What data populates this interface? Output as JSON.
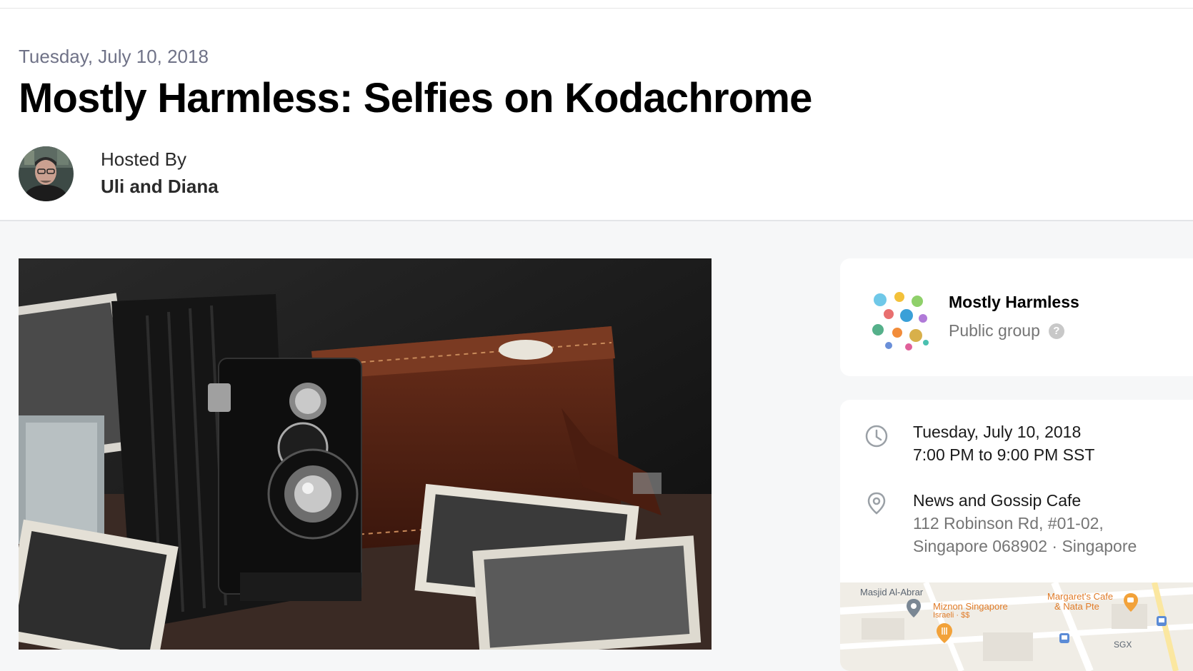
{
  "header": {
    "date": "Tuesday, July 10, 2018",
    "title": "Mostly Harmless: Selfies on Kodachrome",
    "hosted_by_label": "Hosted By",
    "hosts": "Uli and Diana",
    "avatar_icon": "host-avatar"
  },
  "event_image": {
    "icon": "vintage-folding-camera-photo"
  },
  "group": {
    "name": "Mostly Harmless",
    "type": "Public group",
    "help_symbol": "?"
  },
  "details": {
    "date": "Tuesday, July 10, 2018",
    "time": "7:00 PM to 9:00 PM SST",
    "venue_name": "News and Gossip Cafe",
    "address_line1": "112 Robinson Rd, #01-02,",
    "address_line2": "Singapore 068902 · Singapore",
    "clock_icon": "clock-icon",
    "pin_icon": "location-pin-icon"
  },
  "map": {
    "labels": {
      "masjid": "Masjid Al-Abrar",
      "miznon": "Miznon Singapore",
      "miznon_sub": "Israeli · $$",
      "margarets1": "Margaret's Cafe",
      "margarets2": "& Nata Pte",
      "sgx": "SGX"
    },
    "colors": {
      "poi_blue": "#5b8bd6",
      "poi_orange": "#f2a23a",
      "label_orange": "#e07b28",
      "label_gray": "#5a6470"
    }
  },
  "colors": {
    "page_bg": "#f6f7f8",
    "card_bg": "#ffffff",
    "title": "#000000",
    "muted": "#757575"
  }
}
